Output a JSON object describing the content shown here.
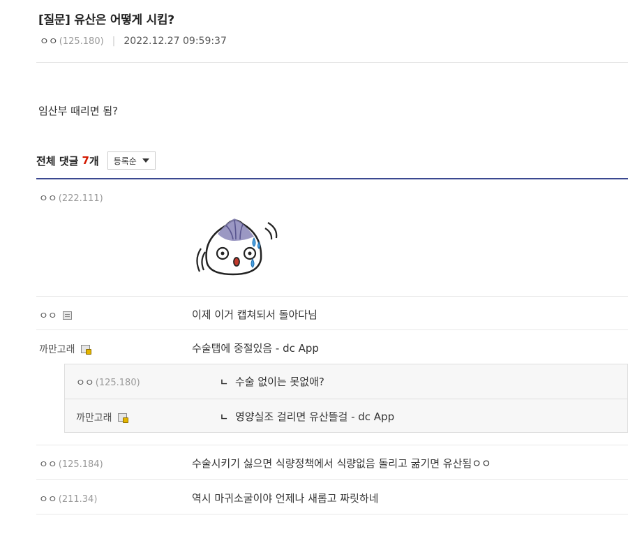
{
  "post": {
    "title": "[질문] 유산은 어떻게 시킴?",
    "author_nick": "ㅇㅇ",
    "author_ip": "(125.180)",
    "date": "2022.12.27 09:59:37",
    "body": "임산부 때리면 됨?"
  },
  "comments_header": {
    "label": "전체 댓글",
    "count": "7",
    "unit": "개",
    "sort_selected": "등록순"
  },
  "comments": [
    {
      "nick": "ㅇㅇ",
      "ip": "(222.111)",
      "text": "",
      "has_dccon": true,
      "dccon_icon": "steamed-bun-sweating-icon"
    },
    {
      "nick": "ㅇㅇ",
      "ip": "",
      "text": "이제 이거 캡쳐되서 돌아다님",
      "member_icon": "plain"
    },
    {
      "nick": "까만고래",
      "ip": "",
      "text": "수술탭에 중절있음 - dc App",
      "member_icon": "gold"
    },
    {
      "nick": "ㅇㅇ",
      "ip": "(125.184)",
      "text": "수술시키기 싫으면 식량정책에서 식량없음 돌리고 굶기면 유산됨ㅇㅇ"
    },
    {
      "nick": "ㅇㅇ",
      "ip": "(211.34)",
      "text": "역시 마귀소굴이야 언제나 새롭고 짜릿하네"
    }
  ],
  "replies": [
    {
      "nick": "ㅇㅇ",
      "ip": "(125.180)",
      "text": "수술 없이는 못없애?",
      "mark": "ㄴ"
    },
    {
      "nick": "까만고래",
      "ip": "",
      "text": "영양실조 걸리면 유산뜰걸 - dc App",
      "mark": "ㄴ",
      "member_icon": "gold"
    }
  ],
  "colors": {
    "navy_rule": "#3b4890",
    "count_red": "#d31900",
    "reply_bg": "#f7f7f7"
  }
}
